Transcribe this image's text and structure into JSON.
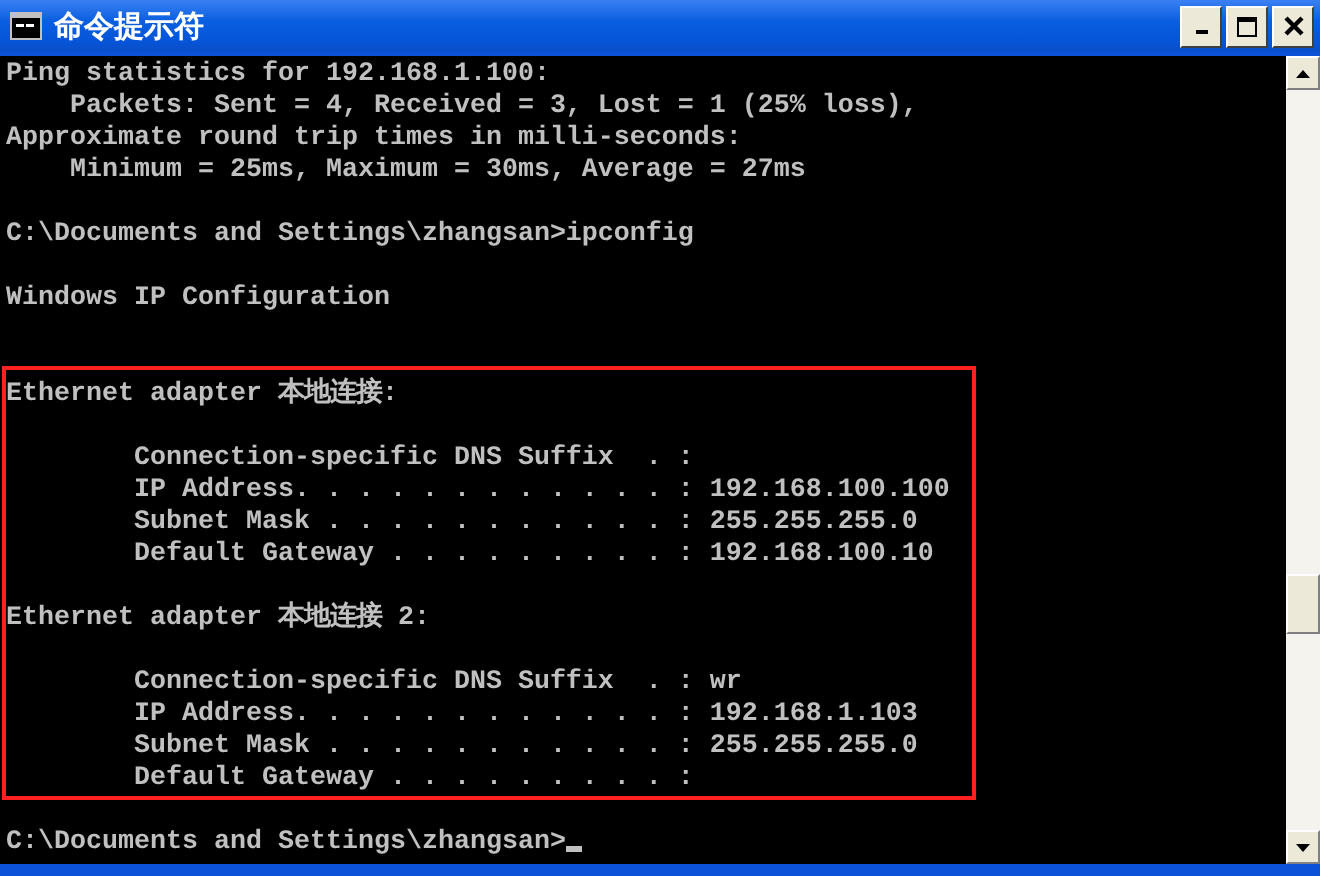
{
  "window": {
    "title": "命令提示符"
  },
  "console": {
    "sections": [
      {
        "highlighted": false,
        "lines": [
          {
            "kind": "text",
            "text": "Ping statistics for 192.168.1.100:"
          },
          {
            "kind": "text",
            "text": "    Packets: Sent = 4, Received = 3, Lost = 1 (25% loss),"
          },
          {
            "kind": "text",
            "text": "Approximate round trip times in milli-seconds:"
          },
          {
            "kind": "text",
            "text": "    Minimum = 25ms, Maximum = 30ms, Average = 27ms"
          },
          {
            "kind": "blank"
          },
          {
            "kind": "text",
            "text": "C:\\Documents and Settings\\zhangsan>ipconfig"
          },
          {
            "kind": "blank"
          },
          {
            "kind": "text",
            "text": "Windows IP Configuration"
          },
          {
            "kind": "blank"
          },
          {
            "kind": "blank"
          }
        ]
      },
      {
        "highlighted": true,
        "lines": [
          {
            "kind": "text",
            "text": "Ethernet adapter 本地连接:"
          },
          {
            "kind": "blank"
          },
          {
            "kind": "text",
            "text": "        Connection-specific DNS Suffix  . :"
          },
          {
            "kind": "text",
            "text": "        IP Address. . . . . . . . . . . . : 192.168.100.100"
          },
          {
            "kind": "text",
            "text": "        Subnet Mask . . . . . . . . . . . : 255.255.255.0"
          },
          {
            "kind": "text",
            "text": "        Default Gateway . . . . . . . . . : 192.168.100.10"
          },
          {
            "kind": "blank"
          },
          {
            "kind": "text",
            "text": "Ethernet adapter 本地连接 2:"
          },
          {
            "kind": "blank"
          },
          {
            "kind": "text",
            "text": "        Connection-specific DNS Suffix  . : wr"
          },
          {
            "kind": "text",
            "text": "        IP Address. . . . . . . . . . . . : 192.168.1.103"
          },
          {
            "kind": "text",
            "text": "        Subnet Mask . . . . . . . . . . . : 255.255.255.0"
          },
          {
            "kind": "text",
            "text": "        Default Gateway . . . . . . . . . :"
          }
        ]
      },
      {
        "highlighted": false,
        "lines": [
          {
            "kind": "blank"
          },
          {
            "kind": "prompt",
            "text": "C:\\Documents and Settings\\zhangsan>",
            "cursor": true
          }
        ]
      }
    ]
  }
}
